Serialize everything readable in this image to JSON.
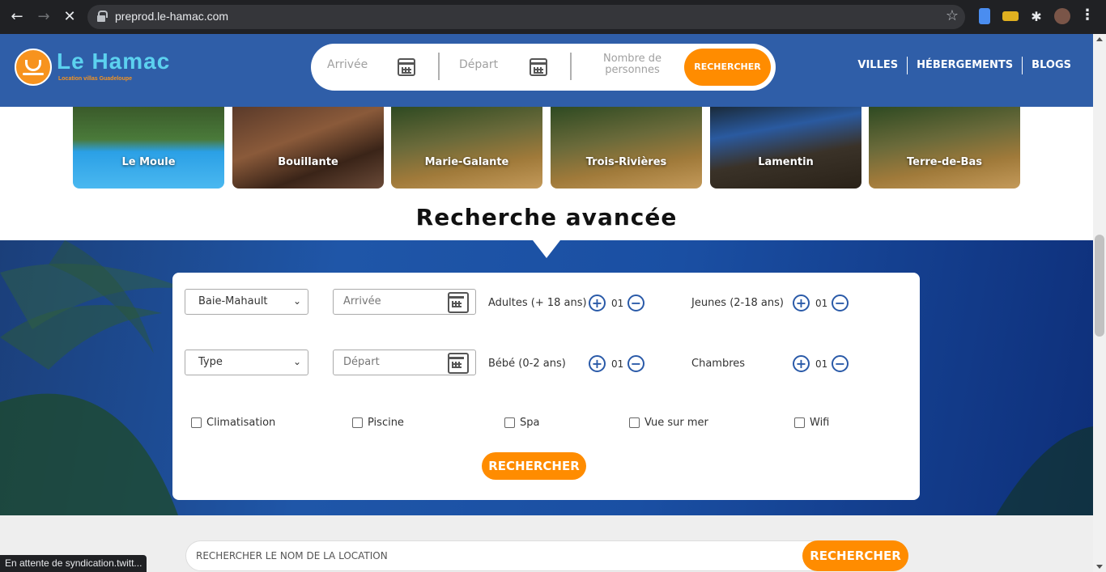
{
  "browser": {
    "url": "preprod.le-hamac.com",
    "status": "En attente de syndication.twitt..."
  },
  "header": {
    "logo_title": "Le Hamac",
    "logo_subtitle": "Location villas Guadeloupe",
    "search": {
      "arrival": "Arrivée",
      "departure": "Départ",
      "persons_line1": "Nombre de",
      "persons_line2": "personnes",
      "button": "RECHERCHER"
    },
    "nav": [
      "VILLES",
      "HÉBERGEMENTS",
      "BLOGS"
    ]
  },
  "cities": [
    "Le Moule",
    "Bouillante",
    "Marie-Galante",
    "Trois-Rivières",
    "Lamentin",
    "Terre-de-Bas"
  ],
  "advanced": {
    "title": "Recherche avancée",
    "city_select": "Baie-Mahault",
    "type_select": "Type",
    "arrival_placeholder": "Arrivée",
    "departure_placeholder": "Départ",
    "counters": {
      "adults": {
        "label": "Adultes (+ 18 ans)",
        "value": "01"
      },
      "youth": {
        "label": "Jeunes (2-18 ans)",
        "value": "01"
      },
      "baby": {
        "label": "Bébé (0-2 ans)",
        "value": "01"
      },
      "rooms": {
        "label": "Chambres",
        "value": "01"
      }
    },
    "amenities": [
      "Climatisation",
      "Piscine",
      "Spa",
      "Vue sur mer",
      "Wifi"
    ],
    "button": "RECHERCHER"
  },
  "name_search": {
    "placeholder": "RECHERCHER LE NOM DE LA LOCATION",
    "button": "RECHERCHER"
  },
  "colors": {
    "header_blue": "#2f5ea8",
    "accent_orange": "#ff8c00",
    "logo_cyan": "#5cd1ef"
  }
}
